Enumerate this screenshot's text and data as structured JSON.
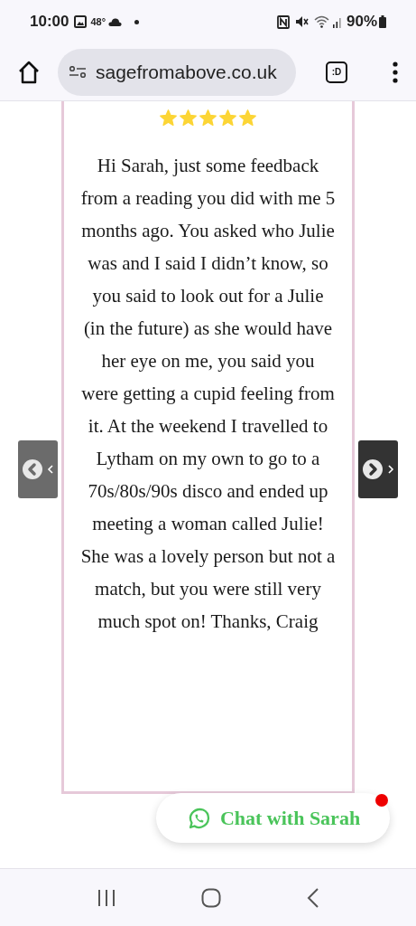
{
  "status_bar": {
    "time": "10:00",
    "temperature": "48°",
    "battery": "90%"
  },
  "browser": {
    "url": "sagefromabove.co.uk",
    "tab_button": ":D"
  },
  "testimonial": {
    "stars": 5,
    "text": "Hi Sarah, just some feedback from a reading you did with me 5 months ago. You asked who Julie was and I said I didn’t know, so you said to look out for a Julie (in the future) as she would have her eye on me, you said you were getting a cupid feeling from it. At the weekend I travelled to Lytham on my own to go to a 70s/80s/90s disco and ended up meeting a woman called Julie! She was a lovely person but not a match, but you were still very much spot on! Thanks, Craig"
  },
  "carousel": {
    "previous_disabled": true,
    "next_disabled": false
  },
  "chat_button": {
    "label": "Chat with Sarah",
    "notification": true
  }
}
